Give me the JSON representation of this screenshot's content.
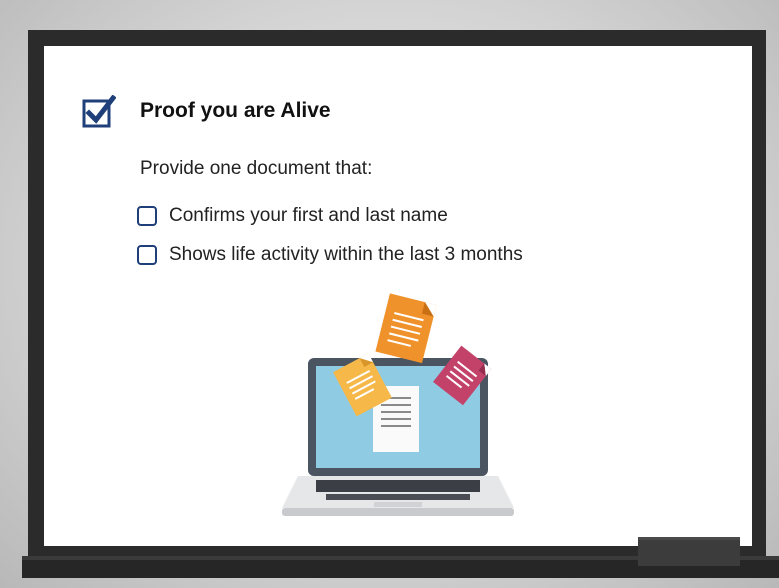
{
  "checklist": {
    "title": "Proof you are Alive",
    "intro": "Provide one document that:",
    "items": [
      "Confirms your first and last name",
      "Shows life activity within the last 3 months"
    ]
  },
  "colors": {
    "check_blue": "#1f3f7a",
    "screen": "#8fcbe3",
    "doc_orange": "#f0922b",
    "doc_yellow": "#f5b849",
    "doc_pink": "#c2426a"
  },
  "icons": [
    "checked-checkbox-icon",
    "checkbox-icon",
    "laptop-documents-illustration"
  ]
}
